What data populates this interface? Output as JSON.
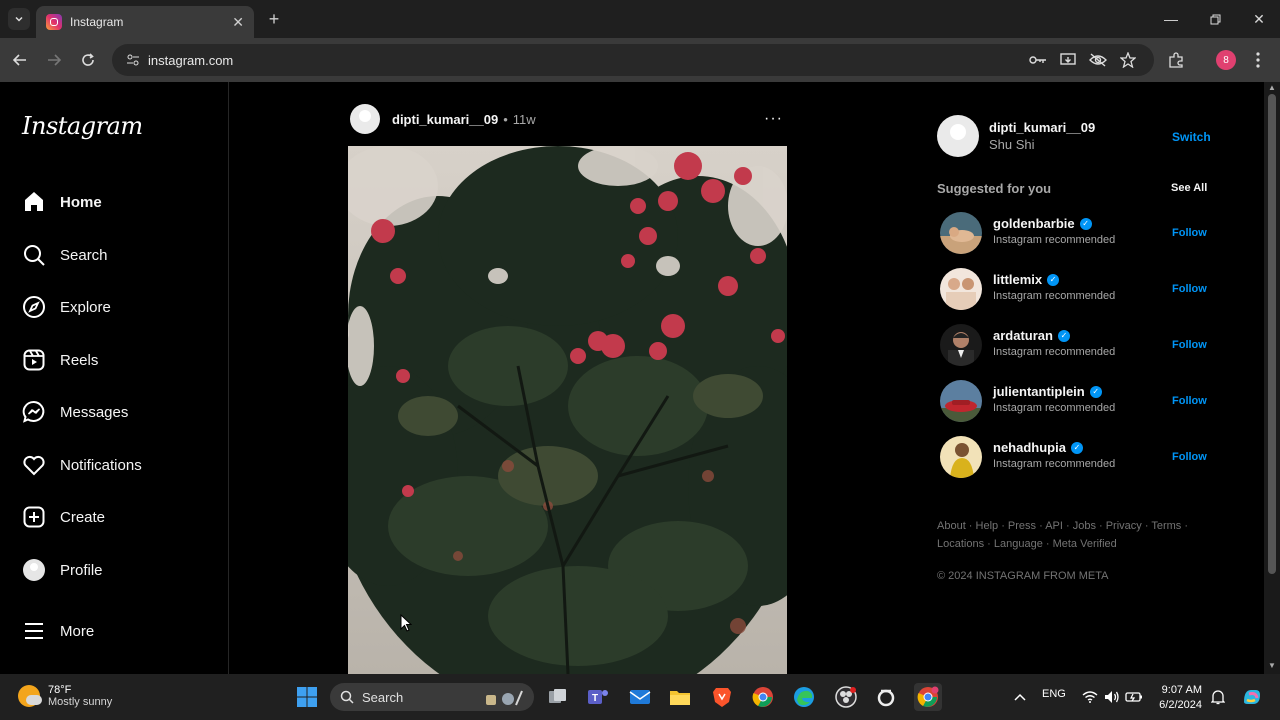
{
  "browser": {
    "tab_title": "Instagram",
    "url": "instagram.com",
    "profile_initial": "8"
  },
  "nav": {
    "logo": "Instagram",
    "items": [
      {
        "label": "Home"
      },
      {
        "label": "Search"
      },
      {
        "label": "Explore"
      },
      {
        "label": "Reels"
      },
      {
        "label": "Messages"
      },
      {
        "label": "Notifications"
      },
      {
        "label": "Create"
      },
      {
        "label": "Profile"
      },
      {
        "label": "More"
      }
    ]
  },
  "post": {
    "username": "dipti_kumari__09",
    "separator": "•",
    "time": "11w",
    "more": "···"
  },
  "account": {
    "username": "dipti_kumari__09",
    "name": "Shu Shi",
    "switch_label": "Switch"
  },
  "suggestions": {
    "title": "Suggested for you",
    "see_all": "See All",
    "items": [
      {
        "username": "goldenbarbie",
        "subtitle": "Instagram recommended",
        "action": "Follow"
      },
      {
        "username": "littlemix",
        "subtitle": "Instagram recommended",
        "action": "Follow"
      },
      {
        "username": "ardaturan",
        "subtitle": "Instagram recommended",
        "action": "Follow"
      },
      {
        "username": "julientantiplein",
        "subtitle": "Instagram recommended",
        "action": "Follow"
      },
      {
        "username": "nehadhupia",
        "subtitle": "Instagram recommended",
        "action": "Follow"
      }
    ]
  },
  "footer": {
    "links": "About · Help · Press · API · Jobs · Privacy · Terms · Locations · Language · Meta Verified",
    "copyright": "© 2024 INSTAGRAM FROM META"
  },
  "taskbar": {
    "temp": "78°F",
    "condition": "Mostly sunny",
    "search_label": "Search",
    "language": "ENG",
    "time": "9:07 AM",
    "date": "6/2/2024"
  }
}
